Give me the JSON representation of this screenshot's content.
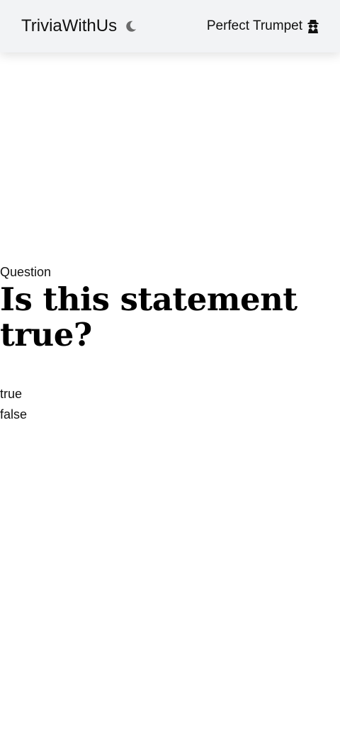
{
  "header": {
    "brand": "TriviaWithUs",
    "theme_toggle_icon": "moon-icon",
    "username": "Perfect Trumpet",
    "user_icon": "spy-icon"
  },
  "quiz": {
    "label": "Question",
    "question": "Is this statement true?",
    "answers": [
      "true",
      "false"
    ]
  },
  "colors": {
    "header_bg": "#f2f3f5",
    "icon_gray": "#6b6b6b",
    "text": "#111111"
  }
}
